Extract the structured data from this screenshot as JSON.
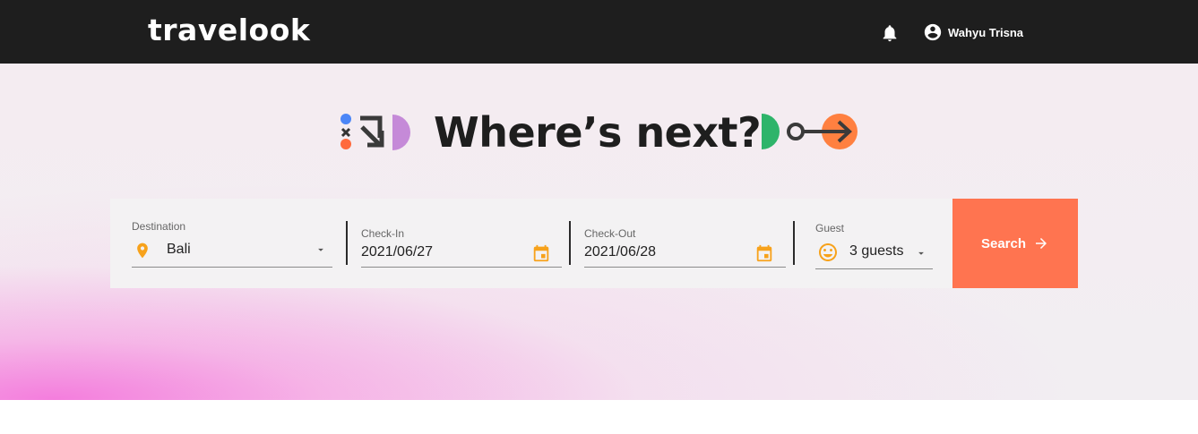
{
  "header": {
    "logo": "travelook",
    "user_name": "Wahyu Trisna",
    "notification_icon": "bell-icon",
    "account_icon": "account-circle-icon"
  },
  "hero": {
    "headline": "Where’s next?"
  },
  "search": {
    "destination": {
      "label": "Destination",
      "value": "Bali",
      "icon": "location-pin-icon"
    },
    "check_in": {
      "label": "Check-In",
      "value": "2021/06/27",
      "icon": "calendar-icon"
    },
    "check_out": {
      "label": "Check-Out",
      "value": "2021/06/28",
      "icon": "calendar-icon"
    },
    "guest": {
      "label": "Guest",
      "value": "3 guests",
      "icon": "smiley-icon"
    },
    "button_label": "Search"
  },
  "colors": {
    "topbar": "#1e1e1e",
    "accent": "#ff7450",
    "icon_accent": "#f7a21b"
  }
}
